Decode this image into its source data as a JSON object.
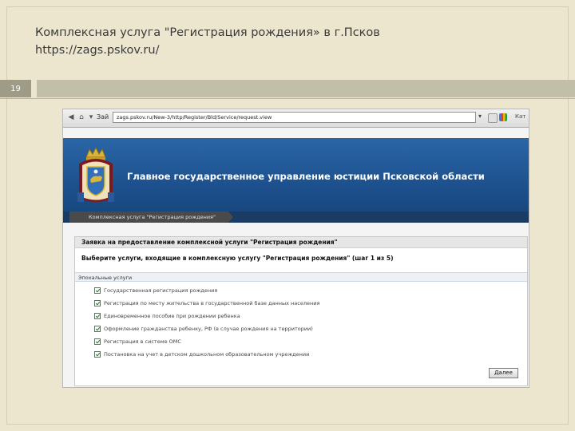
{
  "slide": {
    "title_line1": "Комплексная услуга \"Регистрация рождения» в г.Псков",
    "title_line2": "https://zags.pskov.ru/",
    "slide_number": "19"
  },
  "browser": {
    "go_label": "Зай",
    "url": "zags.pskov.ru/New-3/http/Register/Bld/Service/request.view",
    "toolbar_text": "Кат"
  },
  "site": {
    "header_title": "Главное государственное управление юстиции Псковской области",
    "breadcrumb": "Комплексная услуга \"Регистрация рождения\""
  },
  "form": {
    "heading": "Заявка на предоставление комплексной услуги \"Регистрация рождения\"",
    "subheading": "Выберите услуги, входящие в комплексную услугу \"Регистрация рождения\" (шаг 1 из 5)",
    "section_label": "Эпохальные услуги",
    "services": [
      {
        "label": "Государственная регистрация рождения",
        "checked": true
      },
      {
        "label": "Регистрация по месту жительства в государственной базе данных населения",
        "checked": true
      },
      {
        "label": "Единовременное пособие при рождении ребенка",
        "checked": true
      },
      {
        "label": "Оформление гражданства ребенку, РФ (в случае рождения на территории)",
        "checked": true
      },
      {
        "label": "Регистрация в системе ОМС",
        "checked": true
      },
      {
        "label": "Постановка на учет в детском дошкольном образовательном учреждении",
        "checked": true
      }
    ],
    "next_button": "Далее"
  },
  "colors": {
    "slide_background": "#ece6cf",
    "header_blue": "#1c4f8c",
    "title_bar": "#c2bfa8",
    "slide_number_badge": "#9e9b86"
  }
}
